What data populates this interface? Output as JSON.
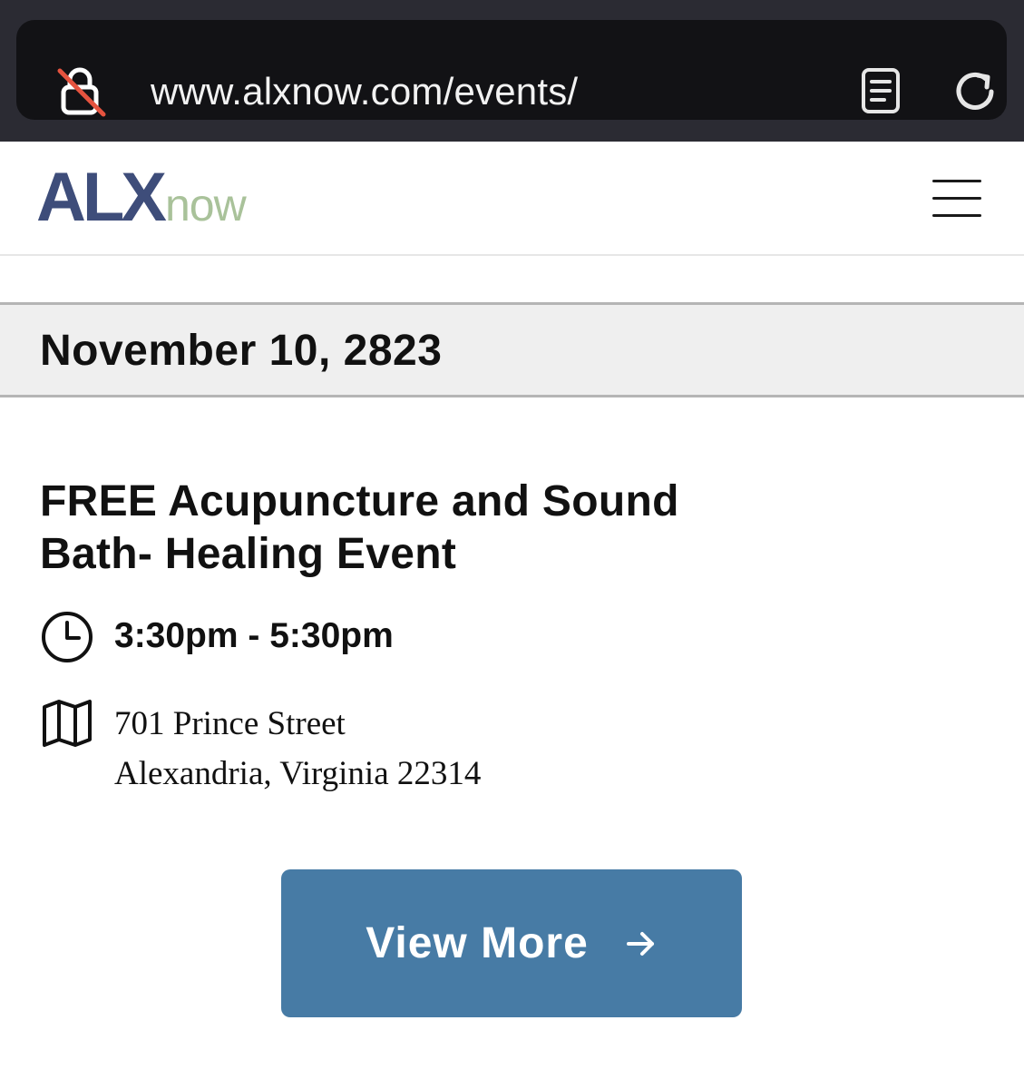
{
  "browser": {
    "url": "www.alxnow.com/events/",
    "icons": {
      "lock": "lock-slashed-icon",
      "reader": "reader-mode-icon",
      "reload": "reload-icon"
    }
  },
  "site": {
    "logo_primary": "ALX",
    "logo_secondary": "now",
    "menu_icon": "hamburger-menu-icon",
    "colors": {
      "logo_primary": "#3e4d7a",
      "logo_secondary": "#a9c29a",
      "button": "#477ba5"
    }
  },
  "event": {
    "date": "November 10, 2823",
    "title": "FREE Acupuncture and Sound Bath- Healing Event",
    "time": "3:30pm - 5:30pm",
    "address_line1": "701 Prince Street",
    "address_line2": "Alexandria, Virginia 22314",
    "cta_label": "View More",
    "icons": {
      "time": "clock-icon",
      "location": "map-icon",
      "cta": "arrow-right-icon"
    }
  }
}
